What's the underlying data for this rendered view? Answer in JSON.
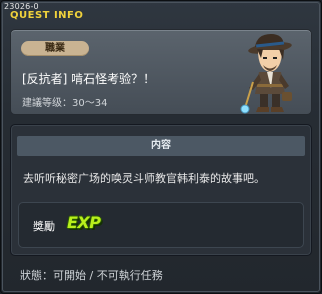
{
  "window": {
    "quest_id": "23026-0",
    "title": "QUEST INFO"
  },
  "quest": {
    "job_label": "職業",
    "name": "[反抗者] 啃石怪考验？！",
    "required_level": "建議等级：30～34"
  },
  "content": {
    "header": "内容",
    "description": "去听听秘密广场的唤灵斗师教官韩利泰的故事吧。"
  },
  "reward": {
    "label": "獎勵",
    "exp": "EXP",
    "exp_color": "#b8f01c"
  },
  "status": {
    "text": "狀態：可開始 / 不可執行任務"
  },
  "colors": {
    "title": "#f0d23c",
    "job_badge": "#c9b392",
    "section_header": "#4c5864"
  }
}
